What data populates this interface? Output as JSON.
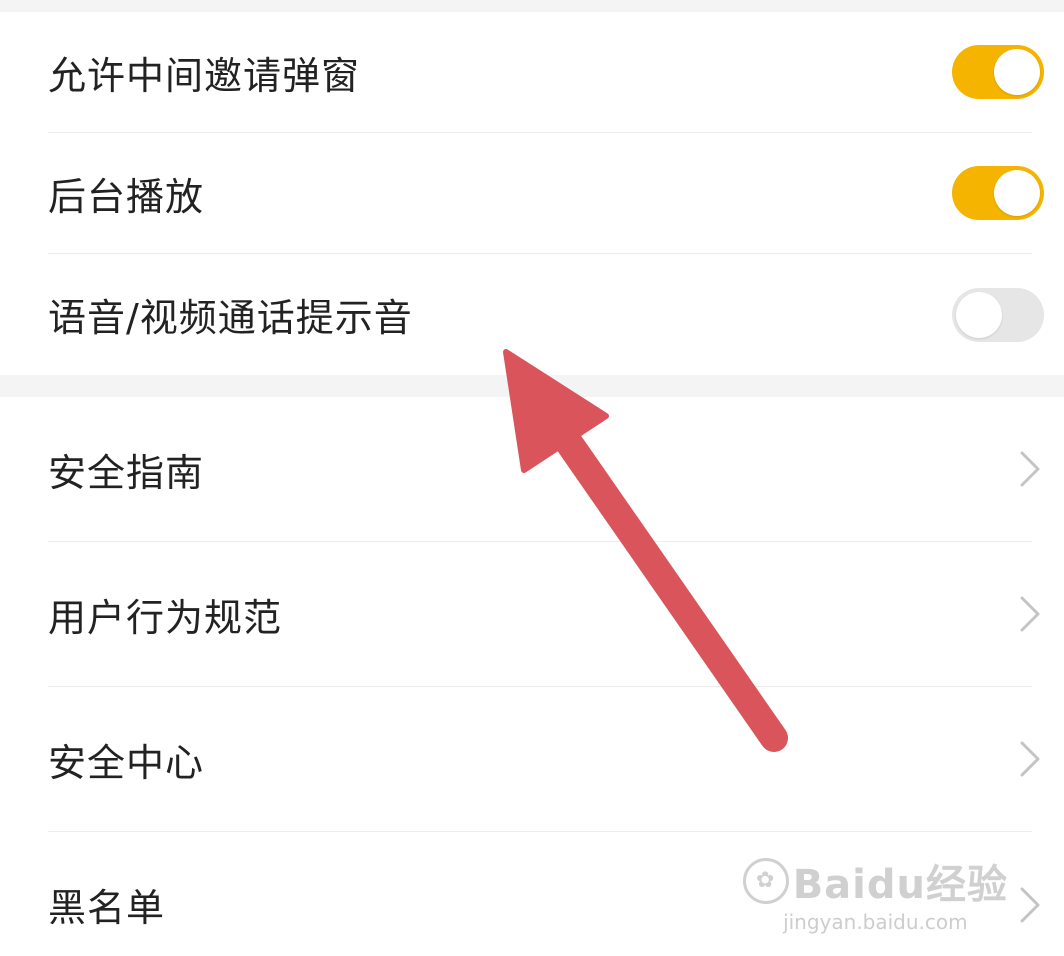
{
  "toggle_settings": [
    {
      "label": "允许中间邀请弹窗",
      "enabled": true
    },
    {
      "label": "后台播放",
      "enabled": true
    },
    {
      "label": "语音/视频通话提示音",
      "enabled": false
    }
  ],
  "menu_items": [
    {
      "label": "安全指南"
    },
    {
      "label": "用户行为规范"
    },
    {
      "label": "安全中心"
    },
    {
      "label": "黑名单"
    }
  ],
  "colors": {
    "toggle_on": "#f5b400",
    "toggle_off": "#e6e6e6",
    "annotation_arrow": "#d9545b"
  },
  "annotation": {
    "type": "arrow",
    "points_to": "语音/视频通话提示音"
  },
  "watermark": {
    "brand": "Baidu经验",
    "url": "jingyan.baidu.com"
  }
}
